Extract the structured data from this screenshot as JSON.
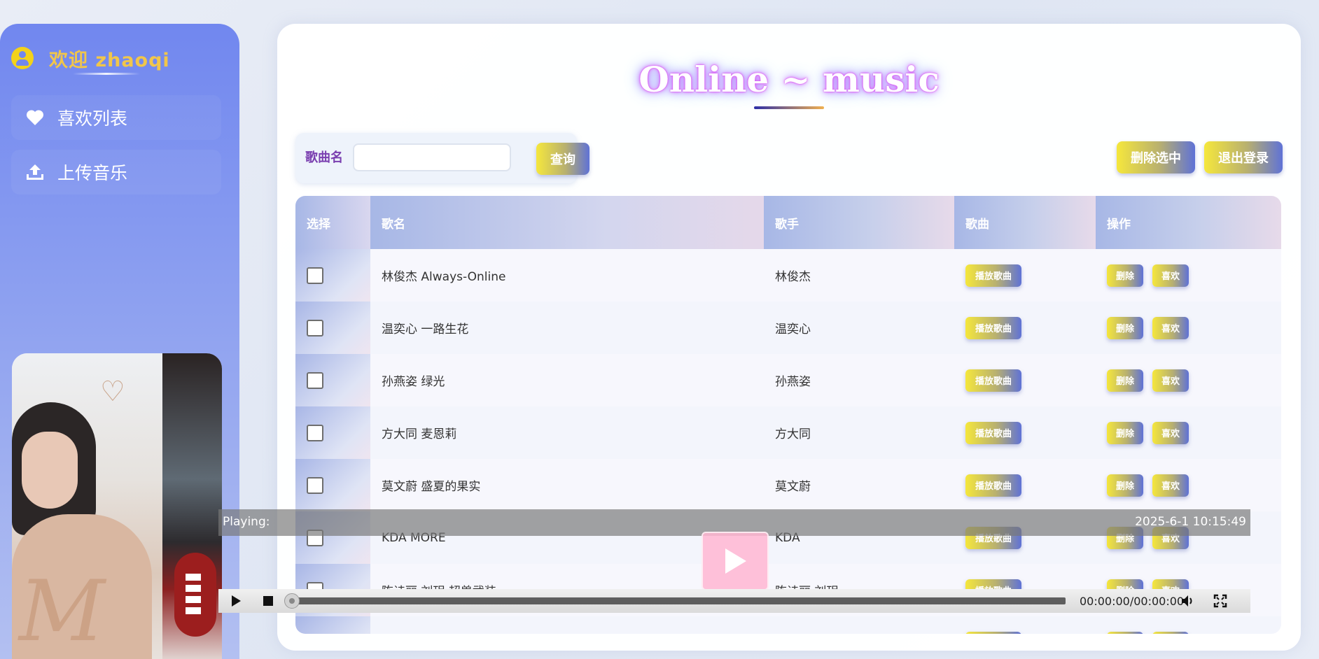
{
  "sidebar": {
    "welcome": "欢迎 zhaoqi",
    "items": [
      {
        "label": "喜欢列表",
        "icon": "heart-icon"
      },
      {
        "label": "上传音乐",
        "icon": "upload-icon"
      }
    ]
  },
  "main": {
    "title": "Online ~ music",
    "search": {
      "label": "歌曲名",
      "placeholder": "",
      "value": "",
      "button": "查询"
    },
    "actions": {
      "delete_selected": "删除选中",
      "logout": "退出登录"
    },
    "table": {
      "headers": [
        "选择",
        "歌名",
        "歌手",
        "歌曲",
        "操作"
      ],
      "play_label": "播放歌曲",
      "delete_label": "删除",
      "like_label": "喜欢",
      "rows": [
        {
          "name": "林俊杰 Always-Online",
          "singer": "林俊杰"
        },
        {
          "name": "温奕心 一路生花",
          "singer": "温奕心"
        },
        {
          "name": "孙燕姿 绿光",
          "singer": "孙燕姿"
        },
        {
          "name": "方大同 麦恩莉",
          "singer": "方大同"
        },
        {
          "name": "莫文蔚 盛夏的果实",
          "singer": "莫文蔚"
        },
        {
          "name": "KDA MORE",
          "singer": "KDA"
        },
        {
          "name": "陈诗丽 刘玥 超兽武装",
          "singer": "陈诗丽 刘玥"
        },
        {
          "name": "",
          "singer": ""
        }
      ]
    }
  },
  "player": {
    "playing_label": "Playing:",
    "datetime": "2025-6-1 10:15:49",
    "time": "00:00:00/00:00:00",
    "progress": 0
  },
  "colors": {
    "accent_yellow": "#f5e73c",
    "accent_blue": "#5f72d6",
    "sidebar_top": "#7187ef",
    "welcome_text": "#f1c64a"
  }
}
